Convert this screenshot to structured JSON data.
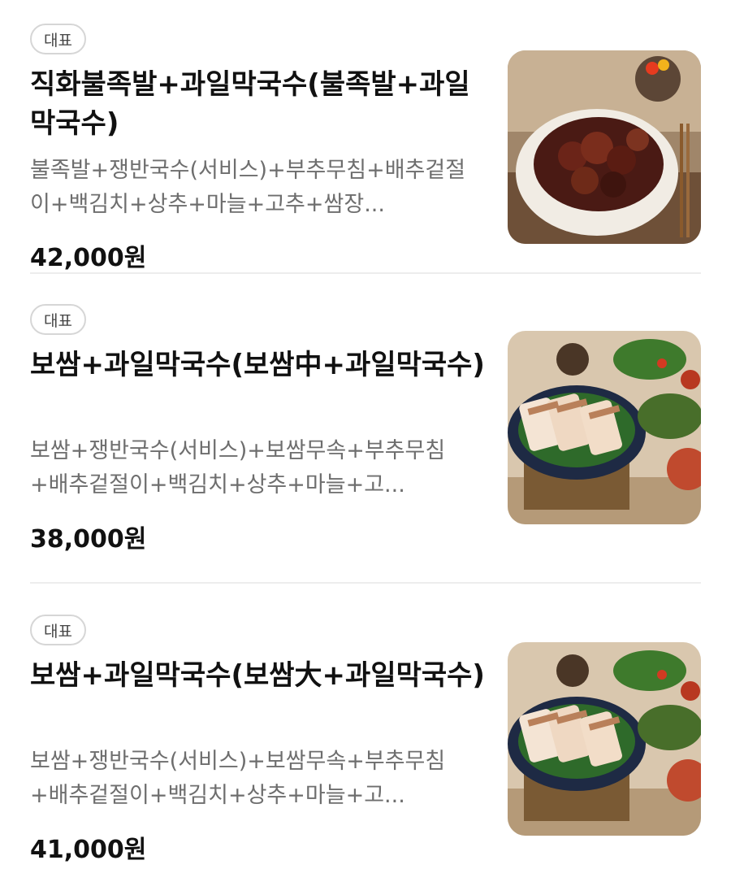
{
  "menu_items": [
    {
      "badge": "대표",
      "title": "직화불족발+과일막국수(불족발+과일막국수)",
      "description": "불족발+쟁반국수(서비스)+부추무침+배추겉절이+백김치+상추+마늘+고추+쌈장...",
      "price": "42,000원",
      "image": "spicy-pork-feet-photo"
    },
    {
      "badge": "대표",
      "title": "보쌈+과일막국수(보쌈中+과일막국수)",
      "description": "보쌈+쟁반국수(서비스)+보쌈무속+부추무침+배추겉절이+백김치+상추+마늘+고...",
      "price": "38,000원",
      "image": "bossam-platter-photo"
    },
    {
      "badge": "대표",
      "title": "보쌈+과일막국수(보쌈大+과일막국수)",
      "description": "보쌈+쟁반국수(서비스)+보쌈무속+부추무침+배추겉절이+백김치+상추+마늘+고...",
      "price": "41,000원",
      "image": "bossam-platter-photo"
    }
  ]
}
